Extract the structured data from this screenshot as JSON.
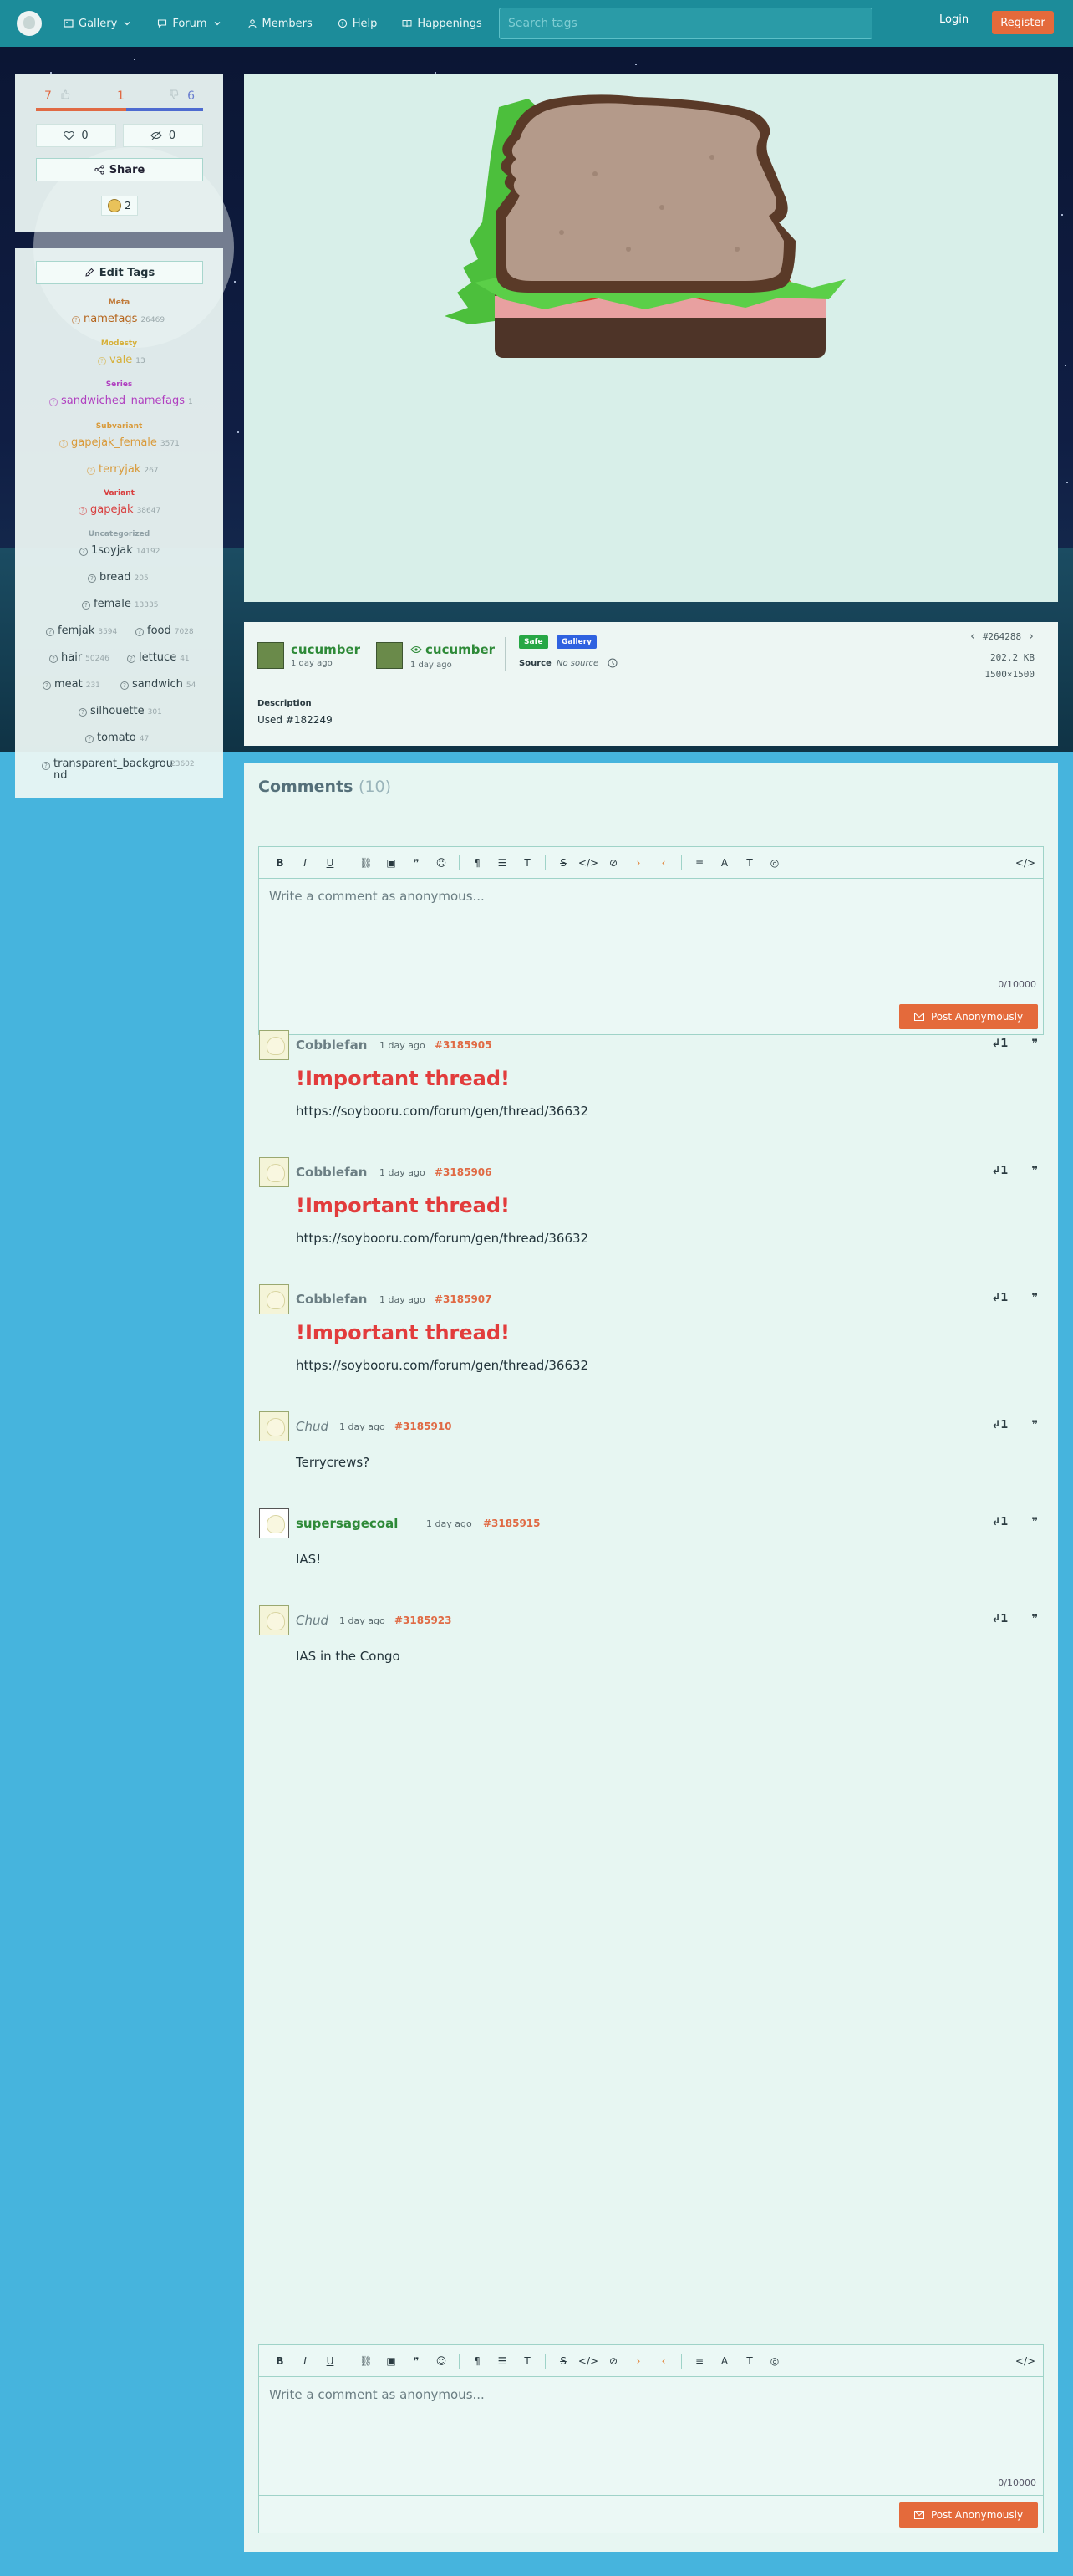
{
  "nav": {
    "items": [
      {
        "label": "Gallery",
        "icon": "image-icon",
        "dropdown": true
      },
      {
        "label": "Forum",
        "icon": "chat-icon",
        "dropdown": true
      },
      {
        "label": "Members",
        "icon": "user-icon",
        "dropdown": false
      },
      {
        "label": "Help",
        "icon": "help-icon",
        "dropdown": false
      },
      {
        "label": "Happenings",
        "icon": "book-icon",
        "dropdown": false
      }
    ],
    "search_placeholder": "Search tags",
    "login": "Login",
    "register": "Register"
  },
  "votes": {
    "up": "7",
    "neutral": "1",
    "down": "6",
    "up_fraction": 0.54,
    "favorites": "0",
    "hidden": "0",
    "share": "Share",
    "reactions": "2"
  },
  "tags": {
    "edit_label": "Edit Tags",
    "categories": {
      "meta": "Meta",
      "modesty": "Modesty",
      "series": "Series",
      "subvariant": "Subvariant",
      "variant": "Variant",
      "uncategorized": "Uncategorized"
    },
    "items": {
      "namefags": {
        "name": "namefags",
        "count": "26469"
      },
      "vale": {
        "name": "vale",
        "count": "13"
      },
      "sandwiched_namefags": {
        "name": "sandwiched_namefags",
        "count": "1"
      },
      "gapejak_female": {
        "name": "gapejak_female",
        "count": "3571"
      },
      "terryjak": {
        "name": "terryjak",
        "count": "267"
      },
      "gapejak": {
        "name": "gapejak",
        "count": "38647"
      },
      "1soyjak": {
        "name": "1soyjak",
        "count": "14192"
      },
      "bread": {
        "name": "bread",
        "count": "205"
      },
      "female": {
        "name": "female",
        "count": "13335"
      },
      "femjak": {
        "name": "femjak",
        "count": "3594"
      },
      "food": {
        "name": "food",
        "count": "7028"
      },
      "hair": {
        "name": "hair",
        "count": "50246"
      },
      "lettuce": {
        "name": "lettuce",
        "count": "41"
      },
      "meat": {
        "name": "meat",
        "count": "231"
      },
      "sandwich": {
        "name": "sandwich",
        "count": "54"
      },
      "silhouette": {
        "name": "silhouette",
        "count": "301"
      },
      "tomato": {
        "name": "tomato",
        "count": "47"
      },
      "transparent_background": {
        "name": "transparent_backgrou nd",
        "count": "23602"
      }
    }
  },
  "info": {
    "uploader": {
      "name": "cucumber",
      "date": "1 day ago"
    },
    "editor": {
      "name": "cucumber",
      "date": "1 day ago"
    },
    "rating_badge": "Safe",
    "gallery_badge": "Gallery",
    "source_label": "Source",
    "source_value": "No source",
    "post_id": "#264288",
    "file_size": "202.2 KB",
    "dimensions": "1500×1500",
    "description_label": "Description",
    "description_text": "Used #182249"
  },
  "comments": {
    "title": "Comments",
    "count": "(10)",
    "editor": {
      "placeholder": "Write a comment as anonymous...",
      "char_count": "0/10000",
      "post_button": "Post Anonymously"
    },
    "items": [
      {
        "name": "Cobblefan",
        "date": "1 day ago",
        "id": "#3185905",
        "heading": "!Important thread!",
        "body": "https://soybooru.com/forum/gen/thread/36632"
      },
      {
        "name": "Cobblefan",
        "date": "1 day ago",
        "id": "#3185906",
        "heading": "!Important thread!",
        "body": "https://soybooru.com/forum/gen/thread/36632"
      },
      {
        "name": "Cobblefan",
        "date": "1 day ago",
        "id": "#3185907",
        "heading": "!Important thread!",
        "body": "https://soybooru.com/forum/gen/thread/36632"
      },
      {
        "name": "Chud",
        "date": "1 day ago",
        "id": "#3185910",
        "heading": "",
        "body": "Terrycrews?"
      },
      {
        "name": "supersagecoal",
        "date": "1 day ago",
        "id": "#3185915",
        "heading": "",
        "body": "IAS!"
      },
      {
        "name": "Chud",
        "date": "1 day ago",
        "id": "#3185923",
        "heading": "",
        "body": "IAS in the Congo"
      }
    ]
  },
  "colors": {
    "topbar": "#1c8c9a",
    "accent": "#e46a3b",
    "page_bg": "#46b4dd",
    "safe_badge": "#27a745",
    "gallery_badge": "#2f62e0"
  }
}
